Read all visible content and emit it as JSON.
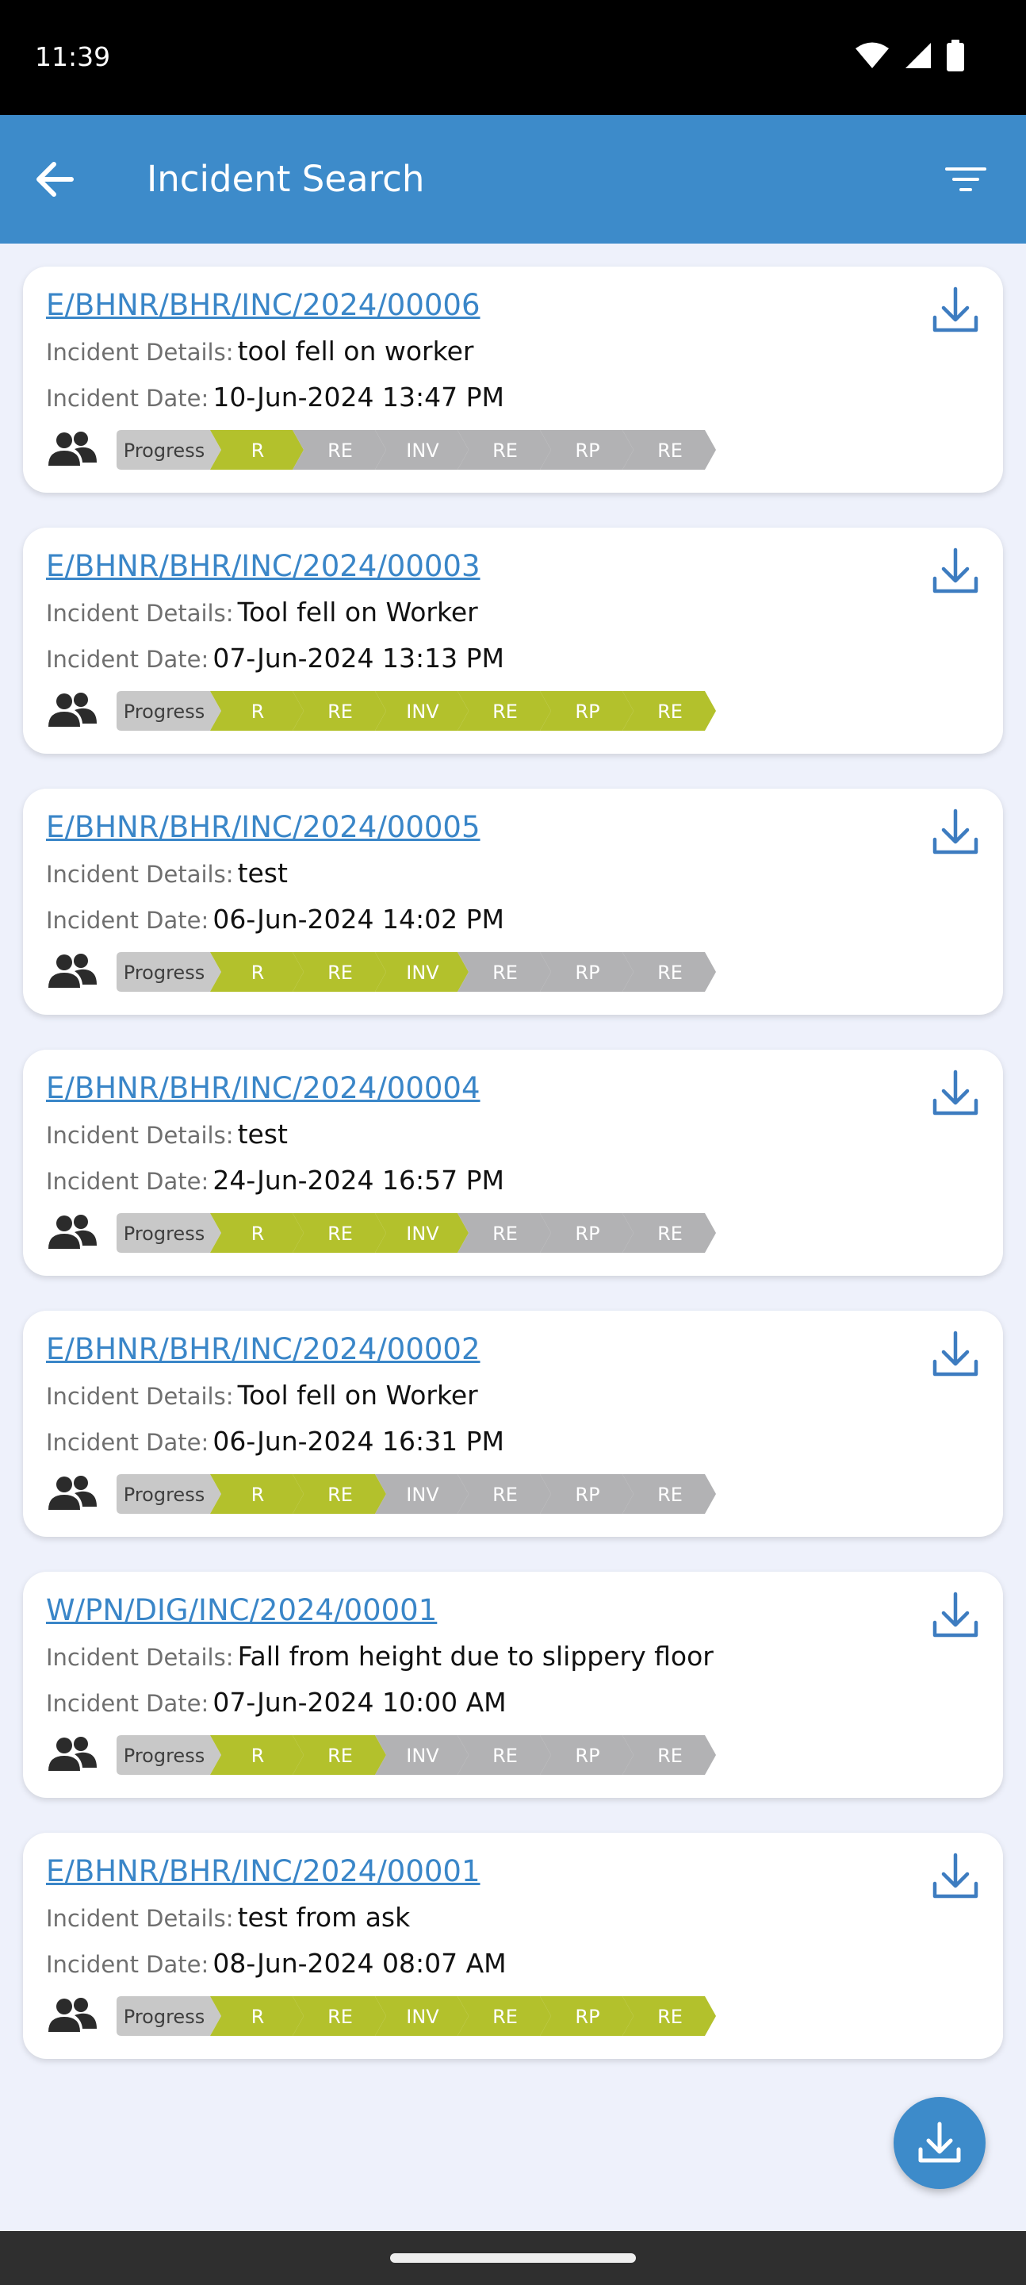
{
  "status_bar": {
    "time": "11:39"
  },
  "app_bar": {
    "title": "Incident Search"
  },
  "labels": {
    "details": "Incident Details:",
    "date": "Incident Date:"
  },
  "colors": {
    "accent": "#3d8bca",
    "step_done": "#b3c12c",
    "step_pending": "#b2b2b4",
    "progress_tag": "#c8c8c8"
  },
  "incidents": [
    {
      "id": "E/BHNR/BHR/INC/2024/00006",
      "details": "tool fell on worker",
      "date": "10-Jun-2024 13:47 PM",
      "steps": [
        "Progress",
        "R",
        "RE",
        "INV",
        "RE",
        "RP",
        "RE"
      ],
      "completed": 1
    },
    {
      "id": "E/BHNR/BHR/INC/2024/00003",
      "details": "Tool fell on Worker",
      "date": "07-Jun-2024 13:13 PM",
      "steps": [
        "Progress",
        "R",
        "RE",
        "INV",
        "RE",
        "RP",
        "RE"
      ],
      "completed": 6
    },
    {
      "id": "E/BHNR/BHR/INC/2024/00005",
      "details": "test",
      "date": "06-Jun-2024 14:02 PM",
      "steps": [
        "Progress",
        "R",
        "RE",
        "INV",
        "RE",
        "RP",
        "RE"
      ],
      "completed": 3
    },
    {
      "id": "E/BHNR/BHR/INC/2024/00004",
      "details": "test",
      "date": "24-Jun-2024 16:57 PM",
      "steps": [
        "Progress",
        "R",
        "RE",
        "INV",
        "RE",
        "RP",
        "RE"
      ],
      "completed": 3
    },
    {
      "id": "E/BHNR/BHR/INC/2024/00002",
      "details": "Tool fell on Worker",
      "date": "06-Jun-2024 16:31 PM",
      "steps": [
        "Progress",
        "R",
        "RE",
        "INV",
        "RE",
        "RP",
        "RE"
      ],
      "completed": 2
    },
    {
      "id": "W/PN/DIG/INC/2024/00001",
      "details": "Fall from height due to slippery floor",
      "date": "07-Jun-2024 10:00 AM",
      "steps": [
        "Progress",
        "R",
        "RE",
        "INV",
        "RE",
        "RP",
        "RE"
      ],
      "completed": 2
    },
    {
      "id": "E/BHNR/BHR/INC/2024/00001",
      "details": "test from ask",
      "date": "08-Jun-2024 08:07 AM",
      "steps": [
        "Progress",
        "R",
        "RE",
        "INV",
        "RE",
        "RP",
        "RE"
      ],
      "completed": 6
    }
  ]
}
